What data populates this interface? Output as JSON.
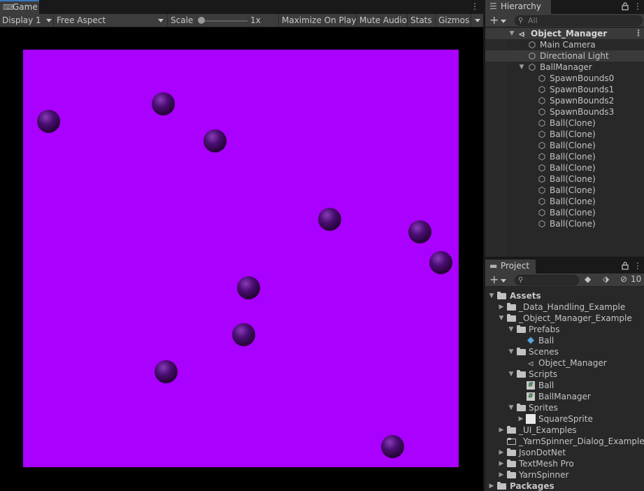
{
  "game": {
    "tab_label": "Game",
    "tab_icon": "gamepad-icon",
    "toolbar": {
      "display": "Display 1",
      "aspect": "Free Aspect",
      "scale_label": "Scale",
      "scale_value": "1x",
      "maximize": "Maximize On Play",
      "mute": "Mute Audio",
      "stats": "Stats",
      "gizmos": "Gizmos"
    },
    "canvas_color": "#aa00ff",
    "ball_count": 10
  },
  "hierarchy": {
    "tab_label": "Hierarchy",
    "tab_icon": "list-icon",
    "search_placeholder": "All",
    "scene": "Object_Manager",
    "items": [
      {
        "label": "Main Camera"
      },
      {
        "label": "Directional Light"
      },
      {
        "label": "BallManager"
      },
      {
        "label": "SpawnBounds0"
      },
      {
        "label": "SpawnBounds1"
      },
      {
        "label": "SpawnBounds2"
      },
      {
        "label": "SpawnBounds3"
      },
      {
        "label": "Ball(Clone)"
      },
      {
        "label": "Ball(Clone)"
      },
      {
        "label": "Ball(Clone)"
      },
      {
        "label": "Ball(Clone)"
      },
      {
        "label": "Ball(Clone)"
      },
      {
        "label": "Ball(Clone)"
      },
      {
        "label": "Ball(Clone)"
      },
      {
        "label": "Ball(Clone)"
      },
      {
        "label": "Ball(Clone)"
      },
      {
        "label": "Ball(Clone)"
      }
    ]
  },
  "project": {
    "tab_label": "Project",
    "tab_icon": "folder-icon",
    "hidden_count": "10",
    "items": [
      {
        "label": "Assets"
      },
      {
        "label": "_Data_Handling_Example"
      },
      {
        "label": "_Object_Manager_Example"
      },
      {
        "label": "Prefabs"
      },
      {
        "label": "Ball"
      },
      {
        "label": "Scenes"
      },
      {
        "label": "Object_Manager"
      },
      {
        "label": "Scripts"
      },
      {
        "label": "Ball"
      },
      {
        "label": "BallManager"
      },
      {
        "label": "Sprites"
      },
      {
        "label": "SquareSprite"
      },
      {
        "label": "_UI_Examples"
      },
      {
        "label": "_YarnSpinner_Dialog_Example"
      },
      {
        "label": "JsonDotNet"
      },
      {
        "label": "TextMesh Pro"
      },
      {
        "label": "YarnSpinner"
      },
      {
        "label": "Packages"
      }
    ]
  }
}
